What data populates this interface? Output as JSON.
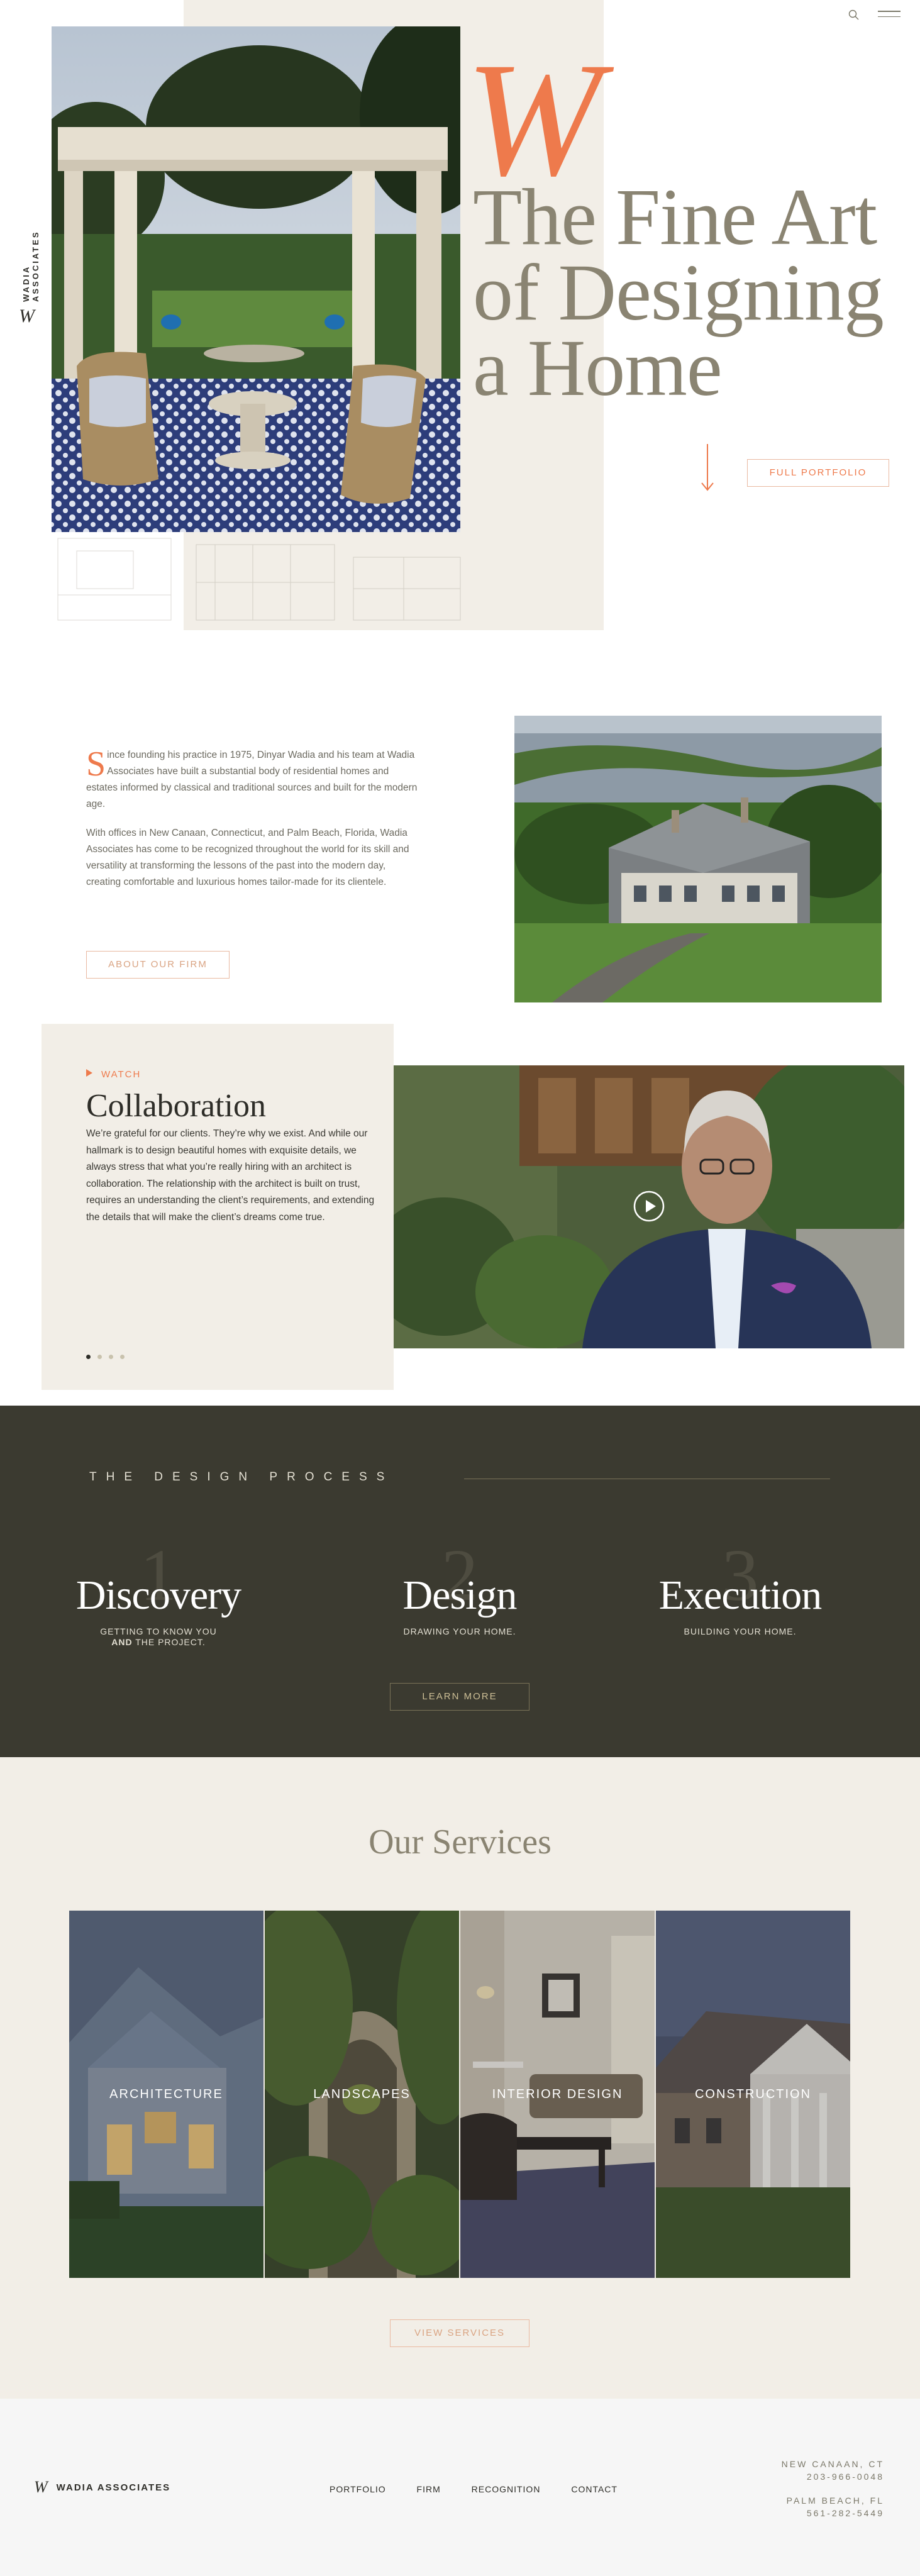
{
  "brand": {
    "name": "WADIA ASSOCIATES",
    "monogram": "W",
    "accent_color": "#ee7a4c",
    "dark_color": "#3b3a30",
    "beige_color": "#f2eee7"
  },
  "header": {
    "icons": [
      "search-icon",
      "menu-icon"
    ]
  },
  "hero": {
    "big_letter": "W",
    "title_line1": "The Fine Art",
    "title_line2": "of Designing",
    "title_line3": "a Home",
    "portfolio_button": "FULL PORTFOLIO",
    "arrow_icon": "arrow-down-icon"
  },
  "about": {
    "dropcap": "S",
    "paragraph1": "ince founding his practice in 1975, Dinyar Wadia and his team at Wadia Associates have built a substantial body of residential homes and estates informed by classical and traditional sources and built for the modern age.",
    "paragraph2": "With offices in New Canaan, Connecticut, and Palm Beach, Florida, Wadia Associates has come to be recognized throughout the world for its skill and versatility at transforming the lessons of the past into the modern day, creating comfortable and luxurious homes tailor-made for its clientele.",
    "button": "ABOUT OUR FIRM"
  },
  "collaboration": {
    "watch_label": "WATCH",
    "title": "Collaboration",
    "body": "We’re grateful for our clients. They’re why we exist. And while our hallmark is to design beautiful homes with exquisite details, we always stress that what you’re really hiring with an architect is collaboration. The relationship with the architect is built on trust, requires an understanding the client’s requirements, and extending the details that will make the client’s dreams come true.",
    "slides": 4,
    "active_slide": 1,
    "play_icon": "play-icon"
  },
  "process": {
    "label": "THE DESIGN PROCESS",
    "steps": [
      {
        "number": "1",
        "name": "Discovery",
        "sub_line1": "GETTING TO KNOW YOU",
        "sub_line2_bold": "AND",
        "sub_line2_rest": " THE PROJECT."
      },
      {
        "number": "2",
        "name": "Design",
        "sub_line1": "DRAWING YOUR HOME.",
        "sub_line2_bold": "",
        "sub_line2_rest": ""
      },
      {
        "number": "3",
        "name": "Execution",
        "sub_line1": "BUILDING YOUR HOME.",
        "sub_line2_bold": "",
        "sub_line2_rest": ""
      }
    ],
    "button": "LEARN MORE"
  },
  "services": {
    "title": "Our Services",
    "items": [
      {
        "label": "ARCHITECTURE"
      },
      {
        "label": "LANDSCAPES"
      },
      {
        "label": "INTERIOR DESIGN"
      },
      {
        "label": "CONSTRUCTION"
      }
    ],
    "button": "VIEW SERVICES"
  },
  "footer": {
    "logo_text": "WADIA ASSOCIATES",
    "nav": [
      "PORTFOLIO",
      "FIRM",
      "RECOGNITION",
      "CONTACT"
    ],
    "offices": [
      {
        "city": "NEW CANAAN, CT",
        "phone": "203-966-0048"
      },
      {
        "city": "PALM BEACH, FL",
        "phone": "561-282-5449"
      }
    ]
  }
}
